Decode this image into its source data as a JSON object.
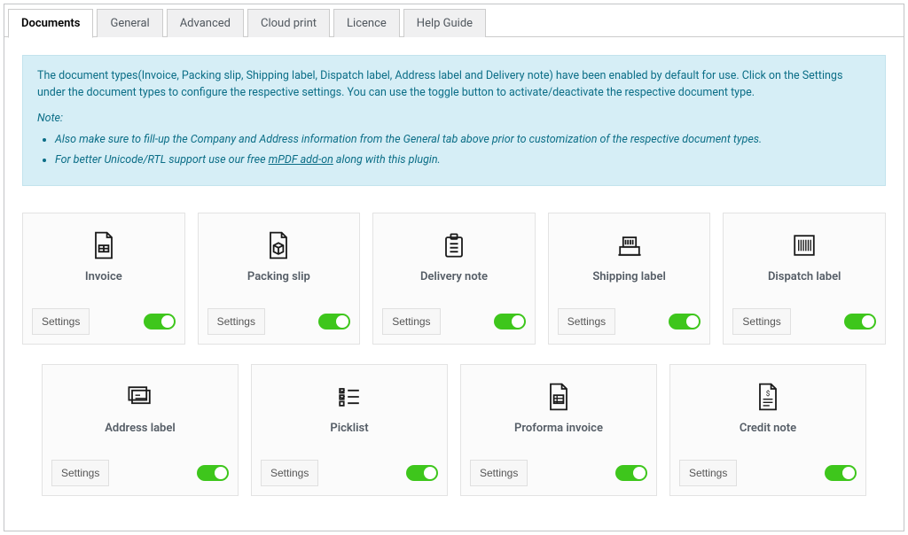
{
  "tabs": {
    "documents": "Documents",
    "general": "General",
    "advanced": "Advanced",
    "cloud_print": "Cloud print",
    "licence": "Licence",
    "help_guide": "Help Guide"
  },
  "info": {
    "main": "The document types(Invoice, Packing slip, Shipping label, Dispatch label, Address label and Delivery note) have been enabled by default for use. Click on the Settings under the document types to configure the respective settings. You can use the toggle button to activate/deactivate the respective document type.",
    "note_label": "Note:",
    "bullet1": "Also make sure to fill-up the Company and Address information from the General tab above prior to customization of the respective document types.",
    "bullet2_prefix": "For better Unicode/RTL support use our free ",
    "bullet2_link": "mPDF add-on",
    "bullet2_suffix": " along with this plugin."
  },
  "settings_label": "Settings",
  "cards": {
    "invoice": {
      "title": "Invoice",
      "enabled": true
    },
    "packing_slip": {
      "title": "Packing slip",
      "enabled": true
    },
    "delivery_note": {
      "title": "Delivery note",
      "enabled": true
    },
    "shipping_label": {
      "title": "Shipping label",
      "enabled": true
    },
    "dispatch_label": {
      "title": "Dispatch label",
      "enabled": true
    },
    "address_label": {
      "title": "Address label",
      "enabled": true
    },
    "picklist": {
      "title": "Picklist",
      "enabled": true
    },
    "proforma_invoice": {
      "title": "Proforma invoice",
      "enabled": true
    },
    "credit_note": {
      "title": "Credit note",
      "enabled": true
    }
  }
}
